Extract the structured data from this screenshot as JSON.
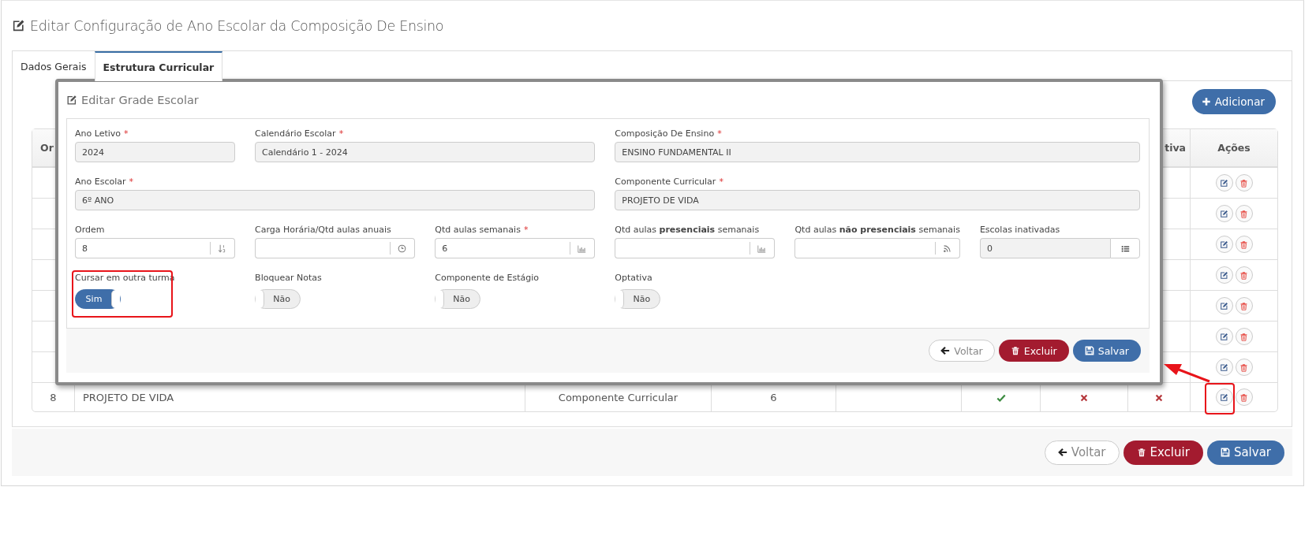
{
  "page": {
    "title": "Editar Configuração de Ano Escolar da Composição De Ensino"
  },
  "tabs": [
    {
      "label": "Dados Gerais",
      "selected": false
    },
    {
      "label": "Estrutura Curricular",
      "selected": true
    }
  ],
  "add_button": {
    "label": "Adicionar"
  },
  "table": {
    "header": {
      "column_1": "Or",
      "column_8": "tiva",
      "actions": "Ações"
    },
    "rows": [
      {
        "kind": "covered"
      },
      {
        "kind": "covered"
      },
      {
        "kind": "covered"
      },
      {
        "kind": "covered"
      },
      {
        "kind": "covered"
      },
      {
        "kind": "covered"
      },
      {
        "kind": "covered"
      },
      {
        "kind": "full",
        "order": "8",
        "name": "PROJETO DE VIDA",
        "type": "Componente Curricular",
        "weekly": "6",
        "column_6": true,
        "column_7": false,
        "column_8": false
      }
    ]
  },
  "footer_buttons": [
    {
      "kind": "back",
      "label": "Voltar"
    },
    {
      "kind": "delete",
      "label": "Excluir"
    },
    {
      "kind": "save",
      "label": "Salvar"
    }
  ],
  "modal": {
    "title": "Editar Grade Escolar",
    "fields": [
      {
        "kind": "text",
        "label": "Ano Letivo",
        "mark": "*",
        "value": "2024",
        "disabled": true
      },
      {
        "kind": "text",
        "label": "Calendário Escolar",
        "mark": "*",
        "value": "Calendário 1 - 2024",
        "disabled": true
      },
      {
        "kind": "text",
        "label": "Composição De Ensino",
        "mark": "*",
        "value": "ENSINO FUNDAMENTAL II",
        "disabled": true
      },
      {
        "kind": "text",
        "label": "Ano Escolar",
        "mark": "*",
        "value": "6º ANO",
        "disabled": true
      },
      {
        "kind": "text",
        "label": "Componente Curricular",
        "mark": "*",
        "value": "PROJETO DE VIDA",
        "disabled": true
      },
      {
        "kind": "addon",
        "label": "Ordem",
        "value": "8",
        "disabled": false
      },
      {
        "kind": "addon",
        "label": "Carga Horária/Qtd aulas anuais",
        "disabled": false
      },
      {
        "kind": "addon",
        "label": "Qtd aulas semanais",
        "mark": "*",
        "value": "6",
        "disabled": false
      },
      {
        "kind": "addon",
        "label": "Qtd aulas **presenciais** semanais",
        "disabled": false
      },
      {
        "kind": "addon",
        "label": "Qtd aulas **não presenciais** semanais",
        "disabled": false
      },
      {
        "kind": "addon",
        "label": "Escolas inativadas",
        "value": "0",
        "disabled": true
      },
      {
        "kind": "toggle",
        "label": "Cursar em outra turma",
        "on": true,
        "text": "Sim"
      },
      {
        "kind": "toggle",
        "label": "Bloquear Notas",
        "on": false,
        "text": "Não"
      },
      {
        "kind": "toggle",
        "label": "Componente de Estágio",
        "on": false,
        "text": "Não"
      },
      {
        "kind": "toggle",
        "label": "Optativa",
        "on": false,
        "text": "Não"
      }
    ],
    "buttons": [
      {
        "kind": "back",
        "label": "Voltar"
      },
      {
        "kind": "delete",
        "label": "Excluir"
      },
      {
        "kind": "save",
        "label": "Salvar"
      }
    ]
  }
}
